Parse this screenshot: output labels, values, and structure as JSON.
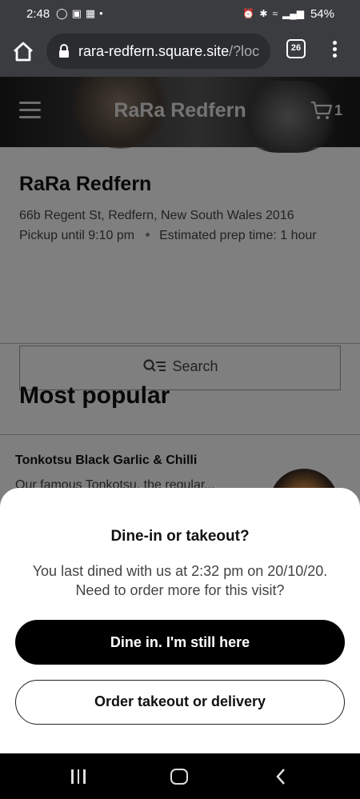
{
  "status_bar": {
    "time": "2:48",
    "battery": "54%"
  },
  "browser": {
    "url_main": "rara-redfern.square.site",
    "url_rest": "/?loc",
    "tab_count": "26"
  },
  "header": {
    "brand": "RaRa Redfern",
    "cart_count": "1"
  },
  "store": {
    "name": "RaRa Redfern",
    "address": "66b Regent St, Redfern, New South Wales 2016",
    "pickup": "Pickup until 9:10 pm",
    "prep_time": "Estimated prep time: 1 hour"
  },
  "search": {
    "label": "Search"
  },
  "section": {
    "title": "Most popular"
  },
  "menu_item": {
    "title": "Tonkotsu Black Garlic & Chilli",
    "description": "Our famous Tonkotsu, the regular..."
  },
  "dialog": {
    "title": "Dine-in or takeout?",
    "message_line1": "You last dined with us at 2:32 pm on 20/10/20.",
    "message_line2": "Need to order more for this visit?",
    "primary_button": "Dine in. I'm still here",
    "secondary_button": "Order takeout or delivery"
  }
}
